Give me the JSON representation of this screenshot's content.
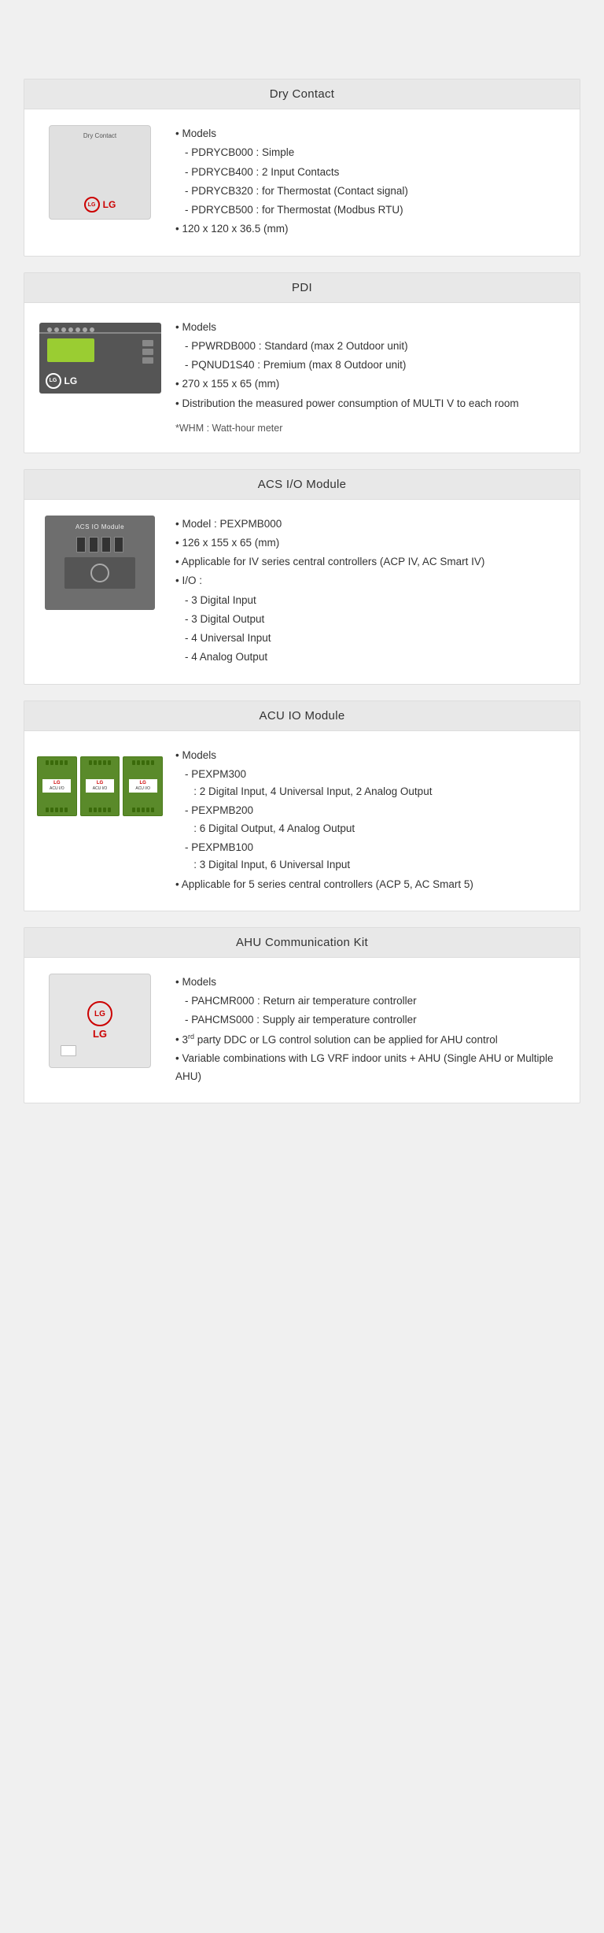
{
  "cards": [
    {
      "id": "dry-contact",
      "title": "Dry Contact",
      "info": {
        "bullet1_label": "Models",
        "sub1": [
          "PDRYCB000 : Simple",
          "PDRYCB400 : 2 Input Contacts",
          "PDRYCB320 : for Thermostat (Contact signal)",
          "PDRYCB500 : for Thermostat (Modbus RTU)"
        ],
        "bullet2": "120 x 120 x 36.5 (mm)"
      }
    },
    {
      "id": "pdi",
      "title": "PDI",
      "info": {
        "bullet1_label": "Models",
        "sub1": [
          "PPWRDB000 : Standard (max 2 Outdoor unit)",
          "PQNUD1S40 : Premium (max 8 Outdoor unit)"
        ],
        "bullet2": "270 x 155 x 65 (mm)",
        "bullet3": "Distribution the measured power consumption of MULTI V to each room",
        "note": "*WHM : Watt-hour meter"
      }
    },
    {
      "id": "acs-io",
      "title": "ACS I/O Module",
      "info": {
        "bullet1": "Model : PEXPMB000",
        "bullet2": "126 x 155 x 65 (mm)",
        "bullet3": "Applicable for IV series central controllers (ACP IV, AC Smart IV)",
        "bullet4_label": "I/O :",
        "sub4": [
          "3 Digital Input",
          "3 Digital Output",
          "4 Universal Input",
          "4 Analog Output"
        ]
      }
    },
    {
      "id": "acu-io",
      "title": "ACU IO Module",
      "info": {
        "bullet1_label": "Models",
        "sub1_items": [
          {
            "name": "PEXPM300",
            "desc": ": 2 Digital Input, 4 Universal Input, 2 Analog Output"
          },
          {
            "name": "PEXPMB200",
            "desc": ": 6 Digital Output, 4 Analog Output"
          },
          {
            "name": "PEXPMB100",
            "desc": ": 3 Digital Input, 6 Universal Input"
          }
        ],
        "bullet2": "Applicable for 5 series central controllers (ACP 5, AC Smart 5)"
      }
    },
    {
      "id": "ahu-comm",
      "title": "AHU Communication Kit",
      "info": {
        "bullet1_label": "Models",
        "sub1": [
          "PAHCMR000 : Return air temperature controller",
          "PAHCMS000 : Supply air temperature controller"
        ],
        "bullet2_prefix": "3",
        "bullet2_sup": "rd",
        "bullet2_suffix": " party DDC or LG control solution can be applied for AHU control",
        "bullet3": "Variable combinations with LG VRF indoor units + AHU (Single AHU or Multiple AHU)"
      }
    }
  ]
}
